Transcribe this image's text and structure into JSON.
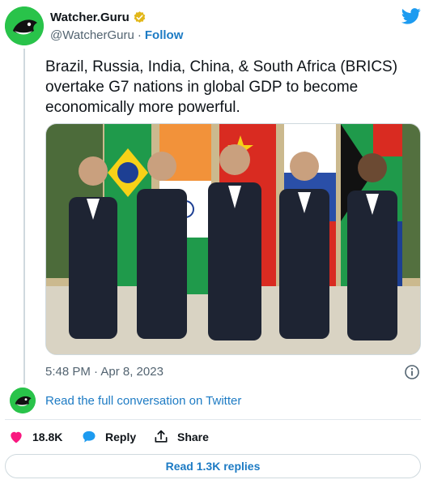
{
  "author": {
    "display_name": "Watcher.Guru",
    "handle": "@WatcherGuru",
    "separator": "·",
    "follow_label": "Follow",
    "verified": true,
    "avatar_color": "#29c34a"
  },
  "tweet": {
    "text": "Brazil, Russia, India, China, & South Africa (BRICS) overtake G7 nations in global GDP to become economically more powerful.",
    "timestamp": "5:48 PM · Apr 8, 2023"
  },
  "media": {
    "icon": "photo-icon",
    "flags": [
      "brazil",
      "india",
      "china",
      "russia",
      "south-africa"
    ]
  },
  "conversation": {
    "link_label": "Read the full conversation on Twitter"
  },
  "actions": {
    "like_count": "18.8K",
    "reply_label": "Reply",
    "share_label": "Share"
  },
  "footer": {
    "read_replies_label": "Read 1.3K replies"
  },
  "colors": {
    "brand_blue": "#1d9bf0",
    "link_blue": "#1d7bc4",
    "like_pink": "#f91880",
    "verified_gold": "#e2b719",
    "text_gray": "#536471"
  }
}
